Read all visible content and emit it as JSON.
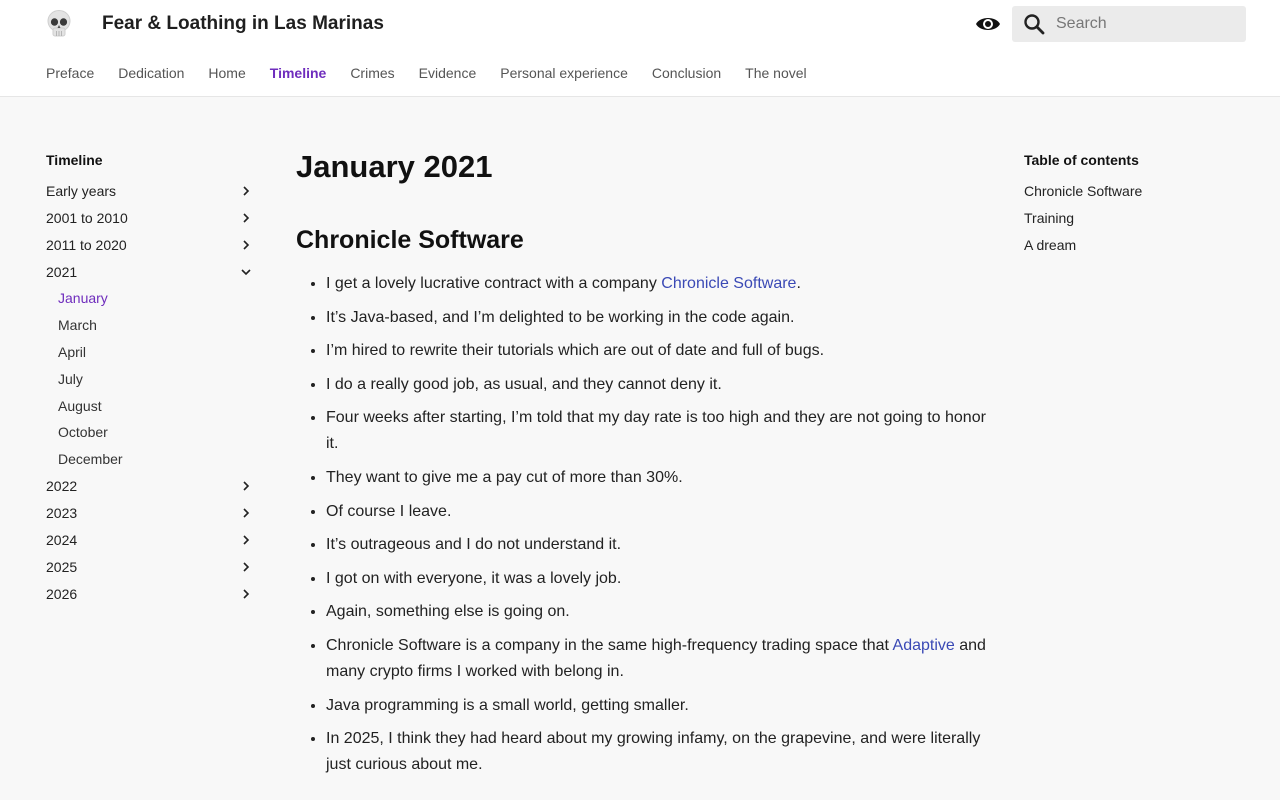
{
  "header": {
    "site_title": "Fear & Loathing in Las Marinas",
    "logo_icon": "skull-icon",
    "theme_icon": "eye-icon",
    "search": {
      "placeholder": "Search",
      "value": ""
    }
  },
  "nav": {
    "items": [
      {
        "label": "Preface"
      },
      {
        "label": "Dedication"
      },
      {
        "label": "Home"
      },
      {
        "label": "Timeline"
      },
      {
        "label": "Crimes"
      },
      {
        "label": "Evidence"
      },
      {
        "label": "Personal experience"
      },
      {
        "label": "Conclusion"
      },
      {
        "label": "The novel"
      }
    ],
    "active": "Timeline",
    "accent": "#6f2dbd"
  },
  "sidebar": {
    "title": "Timeline",
    "sections": [
      {
        "label": "Early years"
      },
      {
        "label": "2001 to 2010"
      },
      {
        "label": "2011 to 2020"
      },
      {
        "label": "2021"
      },
      {
        "label": "2022"
      },
      {
        "label": "2023"
      },
      {
        "label": "2024"
      },
      {
        "label": "2025"
      },
      {
        "label": "2026"
      }
    ],
    "sub_items": [
      {
        "label": "January"
      },
      {
        "label": "March"
      },
      {
        "label": "April"
      },
      {
        "label": "July"
      },
      {
        "label": "August"
      },
      {
        "label": "October"
      },
      {
        "label": "December"
      }
    ]
  },
  "main": {
    "title": "January 2021",
    "section_title": "Chronicle Software",
    "bullets": [
      {
        "pre": "I get a lovely lucrative contract with a company ",
        "link": "Chronicle Software",
        "post": "."
      },
      {
        "pre": "It’s Java-based, and I’m delighted to be working in the code again."
      },
      {
        "pre": "I’m hired to rewrite their tutorials which are out of date and full of bugs."
      },
      {
        "pre": "I do a really good job, as usual, and they cannot deny it."
      },
      {
        "pre": "Four weeks after starting, I’m told that my day rate is too high and they are not going to honor it."
      },
      {
        "pre": "They want to give me a pay cut of more than 30%."
      },
      {
        "pre": "Of course I leave."
      },
      {
        "pre": "It’s outrageous and I do not understand it."
      },
      {
        "pre": "I got on with everyone, it was a lovely job."
      },
      {
        "pre": "Again, something else is going on."
      },
      {
        "pre": "Chronicle Software is a company in the same high-frequency trading space that ",
        "link": "Adaptive",
        "post": " and many crypto firms I worked with belong in."
      },
      {
        "pre": "Java programming is a small world, getting smaller."
      },
      {
        "pre": "In 2025, I think they had heard about my growing infamy, on the grapevine, and were literally just curious about me."
      }
    ],
    "link_color": "#3a49b5"
  },
  "toc": {
    "title": "Table of contents",
    "items": [
      {
        "label": "Chronicle Software"
      },
      {
        "label": "Training"
      },
      {
        "label": "A dream"
      }
    ]
  }
}
